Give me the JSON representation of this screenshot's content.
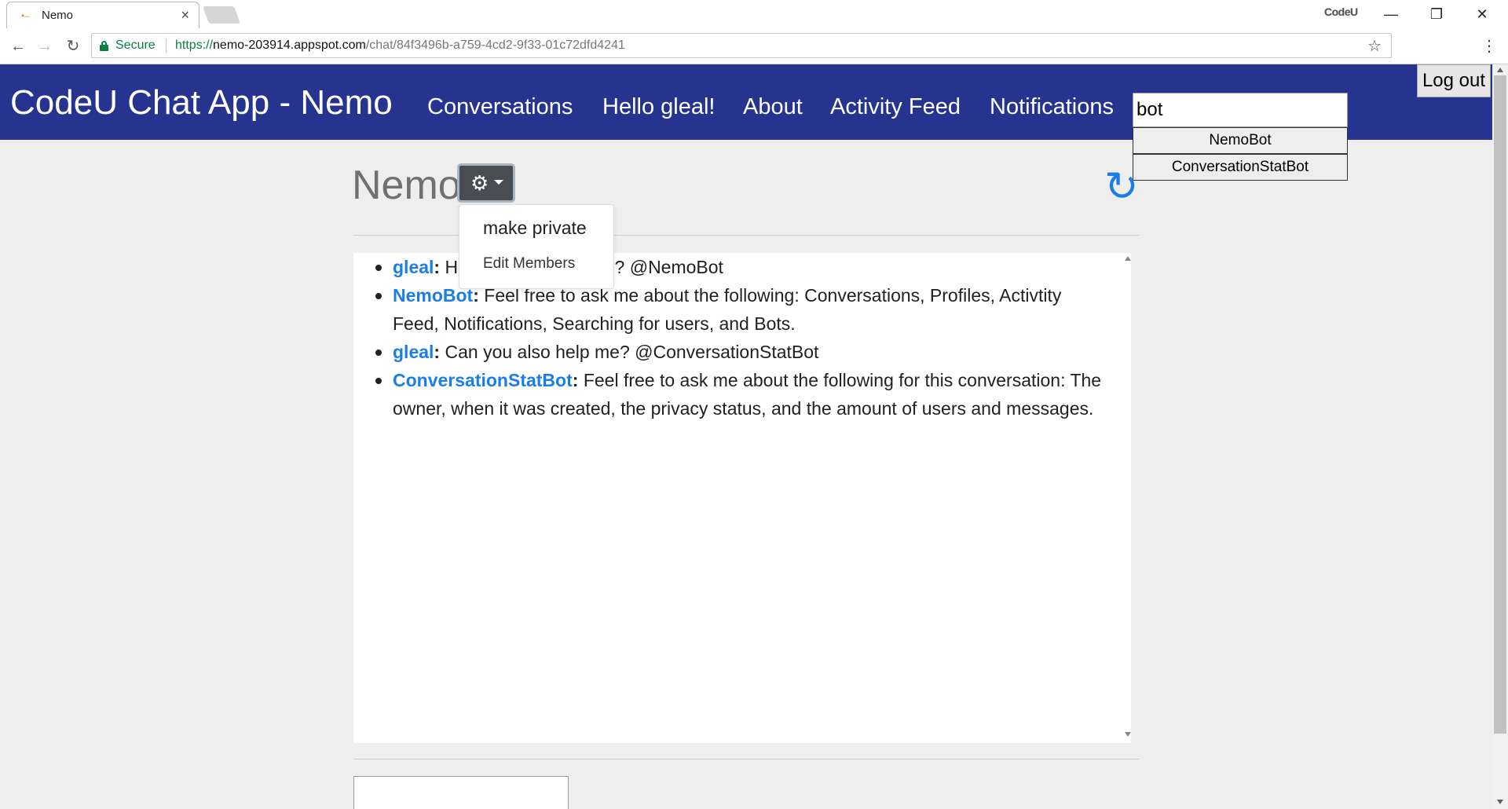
{
  "browser": {
    "tab_title": "Nemo",
    "tab_close": "×",
    "profile_label": "CodeU",
    "window_controls": {
      "minimize": "—",
      "restore": "❐",
      "close": "✕"
    },
    "nav": {
      "back": "←",
      "forward": "→",
      "reload": "↻"
    },
    "security_label": "Secure",
    "url": {
      "scheme": "https://",
      "host": "nemo-203914.appspot.com",
      "path": "/chat/84f3496b-a759-4cd2-9f33-01c72dfd4241"
    },
    "bookmark_icon": "star-icon",
    "menu_icon": "⋮"
  },
  "header": {
    "brand": "CodeU Chat App - Nemo",
    "links": [
      "Conversations",
      "Hello gleal!",
      "About",
      "Activity Feed",
      "Notifications"
    ],
    "search_value": "bot",
    "suggestions": [
      "NemoBot",
      "ConversationStatBot"
    ],
    "logout_label": "Log out",
    "background_color": "#26338f"
  },
  "conversation": {
    "title": "Nemo",
    "settings_icon": "⚙",
    "refresh_icon": "↻",
    "menu": {
      "make_private": "make private",
      "edit_members": "Edit Members"
    },
    "messages": [
      {
        "author": "gleal",
        "text": "Hey can you help me? @NemoBot"
      },
      {
        "author": "NemoBot",
        "text": "Feel free to ask me about the following: Conversations, Profiles, Activtity Feed, Notifications, Searching for users, and Bots."
      },
      {
        "author": "gleal",
        "text": "Can you also help me? @ConversationStatBot"
      },
      {
        "author": "ConversationStatBot",
        "text": "Feel free to ask me about the following for this conversation: The owner, when it was created, the privacy status, and the amount of users and messages."
      }
    ],
    "author_color": "#1a7ee6"
  }
}
